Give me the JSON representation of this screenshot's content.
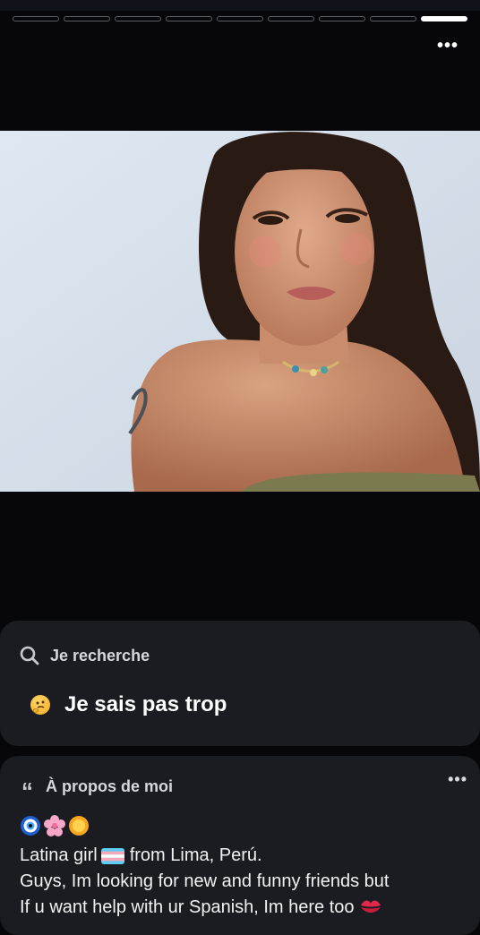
{
  "story": {
    "segments": 9,
    "active_segment": 9,
    "more_label": "•••"
  },
  "looking_for": {
    "label": "Je recherche",
    "icon": "search-icon",
    "answer_icon": "thinking-face-icon",
    "answer": "Je sais pas trop"
  },
  "about": {
    "label": "À propos de moi",
    "icon": "quote-icon",
    "more_label": "•••",
    "bio_emojis": [
      "nazar-amulet-icon",
      "cherry-blossom-icon",
      "sun-icon"
    ],
    "lines": [
      {
        "before": "Latina girl",
        "flag": "transgender-flag-icon",
        "after": "from Lima, Perú."
      },
      {
        "text": "Guys, Im looking for new and funny friends but"
      },
      {
        "text": "If u want help with ur Spanish, Im here too",
        "trailing_icon": "kiss-mark-icon"
      }
    ]
  },
  "colors": {
    "background": "#07070b",
    "card": "#1a1c21",
    "text_muted": "#d5d7dc"
  }
}
